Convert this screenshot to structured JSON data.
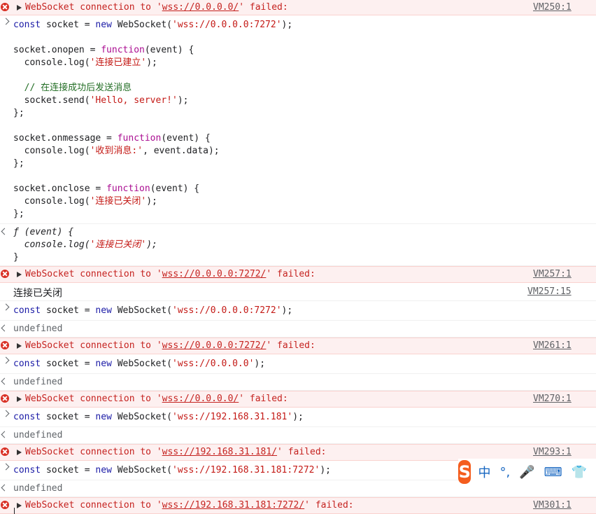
{
  "console": {
    "rows": [
      {
        "type": "error",
        "pre": "WebSocket connection to '",
        "url": "wss://0.0.0.0/",
        "post": "' failed:",
        "source": "VM250:1"
      },
      {
        "type": "input",
        "code": "multi1"
      },
      {
        "type": "output_fn"
      },
      {
        "type": "error",
        "pre": "WebSocket connection to '",
        "url": "wss://0.0.0.0:7272/",
        "post": "' failed:",
        "source": "VM257:1"
      },
      {
        "type": "log",
        "text": "连接已关闭",
        "source": "VM257:15"
      },
      {
        "type": "input",
        "text": "const socket = new WebSocket('wss://0.0.0.0:7272');"
      },
      {
        "type": "output",
        "text": "undefined"
      },
      {
        "type": "error",
        "pre": "WebSocket connection to '",
        "url": "wss://0.0.0.0:7272/",
        "post": "' failed:",
        "source": "VM261:1"
      },
      {
        "type": "input",
        "text": "const socket = new WebSocket('wss://0.0.0.0');"
      },
      {
        "type": "output",
        "text": "undefined"
      },
      {
        "type": "error",
        "pre": "WebSocket connection to '",
        "url": "wss://0.0.0.0/",
        "post": "' failed:",
        "source": "VM270:1"
      },
      {
        "type": "input",
        "text": "const socket = new WebSocket('wss://192.168.31.181');"
      },
      {
        "type": "output",
        "text": "undefined"
      },
      {
        "type": "error",
        "pre": "WebSocket connection to '",
        "url": "wss://192.168.31.181/",
        "post": "' failed:",
        "source": "VM293:1"
      },
      {
        "type": "input",
        "text": "const socket = new WebSocket('wss://192.168.31.181:7272');"
      },
      {
        "type": "output",
        "text": "undefined"
      },
      {
        "type": "error",
        "pre": "WebSocket connection to '",
        "url": "wss://192.168.31.181:7272/",
        "post": "' failed:",
        "source": "VM301:1"
      }
    ],
    "multi1": {
      "l1a": "const",
      "l1b": " socket = ",
      "l1c": "new",
      "l1d": " WebSocket(",
      "l1e": "'wss://0.0.0.0:7272'",
      "l1f": ");",
      "l3a": "socket.onopen = ",
      "l3b": "function",
      "l3c": "(event) {",
      "l4a": "  console.log(",
      "l4b": "'连接已建立'",
      "l4c": ");",
      "l6": "  // 在连接成功后发送消息",
      "l7a": "  socket.send(",
      "l7b": "'Hello, server!'",
      "l7c": ");",
      "l8": "};",
      "l10a": "socket.onmessage = ",
      "l10b": "function",
      "l10c": "(event) {",
      "l11a": "  console.log(",
      "l11b": "'收到消息:'",
      "l11c": ", event.data);",
      "l12": "};",
      "l14a": "socket.onclose = ",
      "l14b": "function",
      "l14c": "(event) {",
      "l15a": "  console.log(",
      "l15b": "'连接已关闭'",
      "l15c": ");",
      "l16": "};"
    },
    "fn_output": {
      "l1": "ƒ (event) {",
      "l2a": "  console.log(",
      "l2b": "'连接已关闭'",
      "l2c": ");",
      "l3": "}"
    }
  },
  "ime": {
    "logo": "S",
    "items": [
      "中",
      "°,",
      "🎤",
      "⌨",
      "👕"
    ]
  }
}
